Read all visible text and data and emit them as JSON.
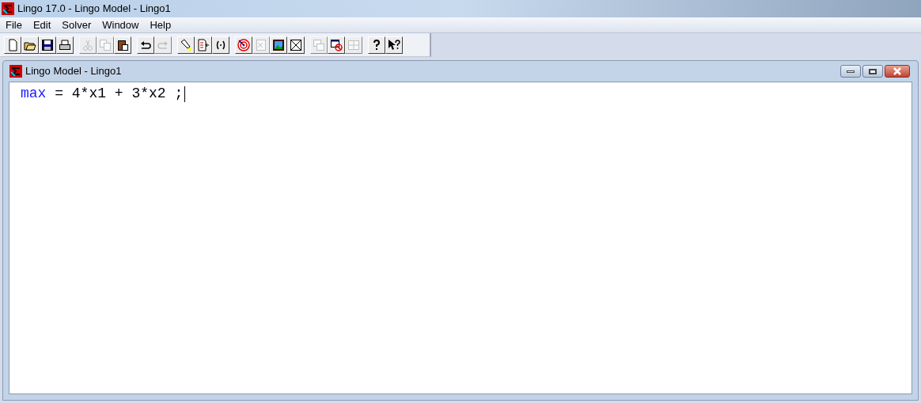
{
  "window": {
    "title": "Lingo 17.0 - Lingo Model - Lingo1"
  },
  "menu": [
    "File",
    "Edit",
    "Solver",
    "Window",
    "Help"
  ],
  "toolbar": [
    [
      {
        "kind": "new",
        "disabled": false
      },
      {
        "kind": "open",
        "disabled": false
      },
      {
        "kind": "save",
        "disabled": false
      },
      {
        "kind": "print",
        "disabled": false
      }
    ],
    [
      {
        "kind": "cut",
        "disabled": true
      },
      {
        "kind": "copy",
        "disabled": true
      },
      {
        "kind": "paste",
        "disabled": false
      }
    ],
    [
      {
        "kind": "undo",
        "disabled": false
      },
      {
        "kind": "redo",
        "disabled": true
      }
    ],
    [
      {
        "kind": "find",
        "disabled": false
      },
      {
        "kind": "goto",
        "disabled": false
      },
      {
        "kind": "match",
        "disabled": false
      }
    ],
    [
      {
        "kind": "solve",
        "disabled": false
      },
      {
        "kind": "solution",
        "disabled": true
      },
      {
        "kind": "picture",
        "disabled": false
      },
      {
        "kind": "close",
        "disabled": false
      }
    ],
    [
      {
        "kind": "cascade",
        "disabled": true
      },
      {
        "kind": "closeall",
        "disabled": false
      },
      {
        "kind": "tile",
        "disabled": true
      }
    ],
    [
      {
        "kind": "help",
        "disabled": false
      },
      {
        "kind": "contexthelp",
        "disabled": false
      }
    ]
  ],
  "child_window": {
    "title": "Lingo Model - Lingo1",
    "code": [
      {
        "text": "max",
        "kind": "keyword"
      },
      {
        "text": " = 4*x1 + 3*x2 ;",
        "kind": "plain"
      }
    ]
  }
}
